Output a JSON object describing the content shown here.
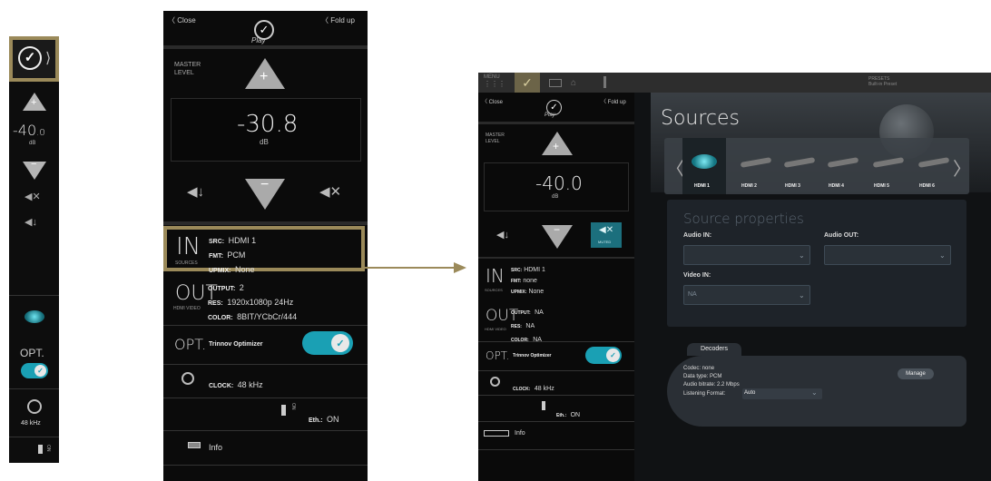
{
  "strip": {
    "logo_icon": "play-logo-icon",
    "level_int": "-40",
    "level_dec": ".0",
    "level_unit": "dB",
    "toggle_label": "OPT.",
    "clock": "48 kHz",
    "eth_text": "ON"
  },
  "mid": {
    "close": "Close",
    "fold": "Fold up",
    "logo_text": "Play",
    "master_label_1": "MASTER",
    "master_label_2": "LEVEL",
    "level": "-30.8",
    "level_unit": "dB",
    "in": {
      "big": "IN",
      "caption": "SOURCES",
      "src_label": "SRC:",
      "src": "HDMI 1",
      "fmt_label": "FMT:",
      "fmt": "PCM",
      "upmix_label": "UPMIX:",
      "upmix": "None"
    },
    "out": {
      "big": "OUT",
      "caption": "HDMI VIDEO",
      "output_label": "OUTPUT:",
      "output": "2",
      "res_label": "RES:",
      "res": "1920x1080p 24Hz",
      "color_label": "COLOR:",
      "color": "8BIT/YCbCr/444"
    },
    "opt": {
      "big": "OPT.",
      "label": "Trinnov Optimizer",
      "on": true
    },
    "clock_label": "CLOCK:",
    "clock": "48 kHz",
    "eth_label": "Eth.:",
    "eth": "ON",
    "eth_vert": "ON",
    "info": "Info"
  },
  "right": {
    "top_menu": "MENU",
    "top_right_1": "PRESETS",
    "top_right_2": "Built-in Preset",
    "side": {
      "close": "Close",
      "fold": "Fold up",
      "logo_text": "Play",
      "master_label_1": "MASTER",
      "master_label_2": "LEVEL",
      "level": "-40.0",
      "level_unit": "dB",
      "muted": "MUTED",
      "in": {
        "big": "IN",
        "caption": "SOURCES",
        "src_label": "SRC:",
        "src": "HDMI 1",
        "fmt_label": "FMT:",
        "fmt": "none",
        "upmix_label": "UPMIX:",
        "upmix": "None"
      },
      "out": {
        "big": "OUT",
        "caption": "HDMI VIDEO",
        "output_label": "OUTPUT:",
        "output": "NA",
        "res_label": "RES:",
        "res": "NA",
        "color_label": "COLOR:",
        "color": "NA"
      },
      "opt": {
        "big": "OPT.",
        "label": "Trinnov Optimizer"
      },
      "clock_label": "CLOCK:",
      "clock": "48 kHz",
      "eth_label": "Eth.:",
      "eth": "ON",
      "info": "Info"
    },
    "sources_title": "Sources",
    "hdmi": [
      "HDMI 1",
      "HDMI 2",
      "HDMI 3",
      "HDMI 4",
      "HDMI 5",
      "HDMI 6"
    ],
    "props_title": "Source properties",
    "audio_in": "Audio IN:",
    "audio_out": "Audio OUT:",
    "video_in": "Video IN:",
    "video_in_value": "NA",
    "decoders_tab": "Decoders",
    "codec": "Codec: none",
    "data_type": "Data type: PCM",
    "audio_bitrate": "Audio bitrate: 2.2 Mbps",
    "listening_label": "Listening Format:",
    "listening_value": "Auto",
    "manage": "Manage"
  },
  "colors": {
    "accent_gold": "#9b8a5a",
    "toggle_teal": "#1aa0b4",
    "muted_teal": "#1c6f7d"
  }
}
